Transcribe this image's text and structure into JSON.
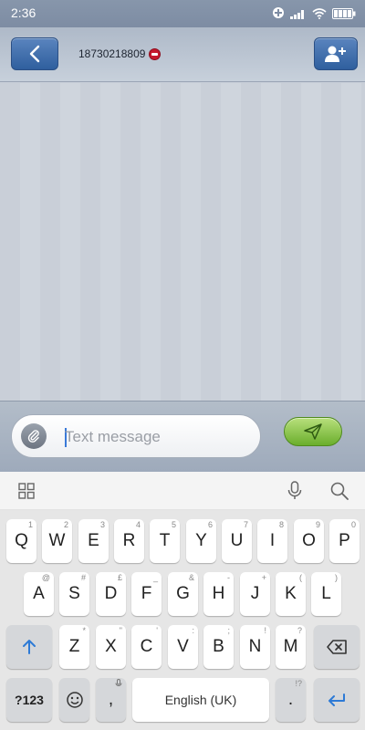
{
  "status_bar": {
    "time": "2:36"
  },
  "header": {
    "contact_number": "18730218809"
  },
  "compose": {
    "placeholder": "Text message"
  },
  "keyboard": {
    "row1": [
      {
        "label": "Q",
        "hint": "1"
      },
      {
        "label": "W",
        "hint": "2"
      },
      {
        "label": "E",
        "hint": "3"
      },
      {
        "label": "R",
        "hint": "4"
      },
      {
        "label": "T",
        "hint": "5"
      },
      {
        "label": "Y",
        "hint": "6"
      },
      {
        "label": "U",
        "hint": "7"
      },
      {
        "label": "I",
        "hint": "8"
      },
      {
        "label": "O",
        "hint": "9"
      },
      {
        "label": "P",
        "hint": "0"
      }
    ],
    "row2": [
      {
        "label": "A",
        "hint": "@"
      },
      {
        "label": "S",
        "hint": "#"
      },
      {
        "label": "D",
        "hint": "£"
      },
      {
        "label": "F",
        "hint": "_"
      },
      {
        "label": "G",
        "hint": "&"
      },
      {
        "label": "H",
        "hint": "-"
      },
      {
        "label": "J",
        "hint": "+"
      },
      {
        "label": "K",
        "hint": "("
      },
      {
        "label": "L",
        "hint": ")"
      }
    ],
    "row3": [
      {
        "label": "Z",
        "hint": "*"
      },
      {
        "label": "X",
        "hint": "\""
      },
      {
        "label": "C",
        "hint": "'"
      },
      {
        "label": "V",
        "hint": ":"
      },
      {
        "label": "B",
        "hint": ";"
      },
      {
        "label": "N",
        "hint": "!"
      },
      {
        "label": "M",
        "hint": "?"
      }
    ],
    "symbols_label": "?123",
    "comma_label": ",",
    "space_label": "English (UK)",
    "period_label": ".",
    "period_hint": "!?"
  }
}
